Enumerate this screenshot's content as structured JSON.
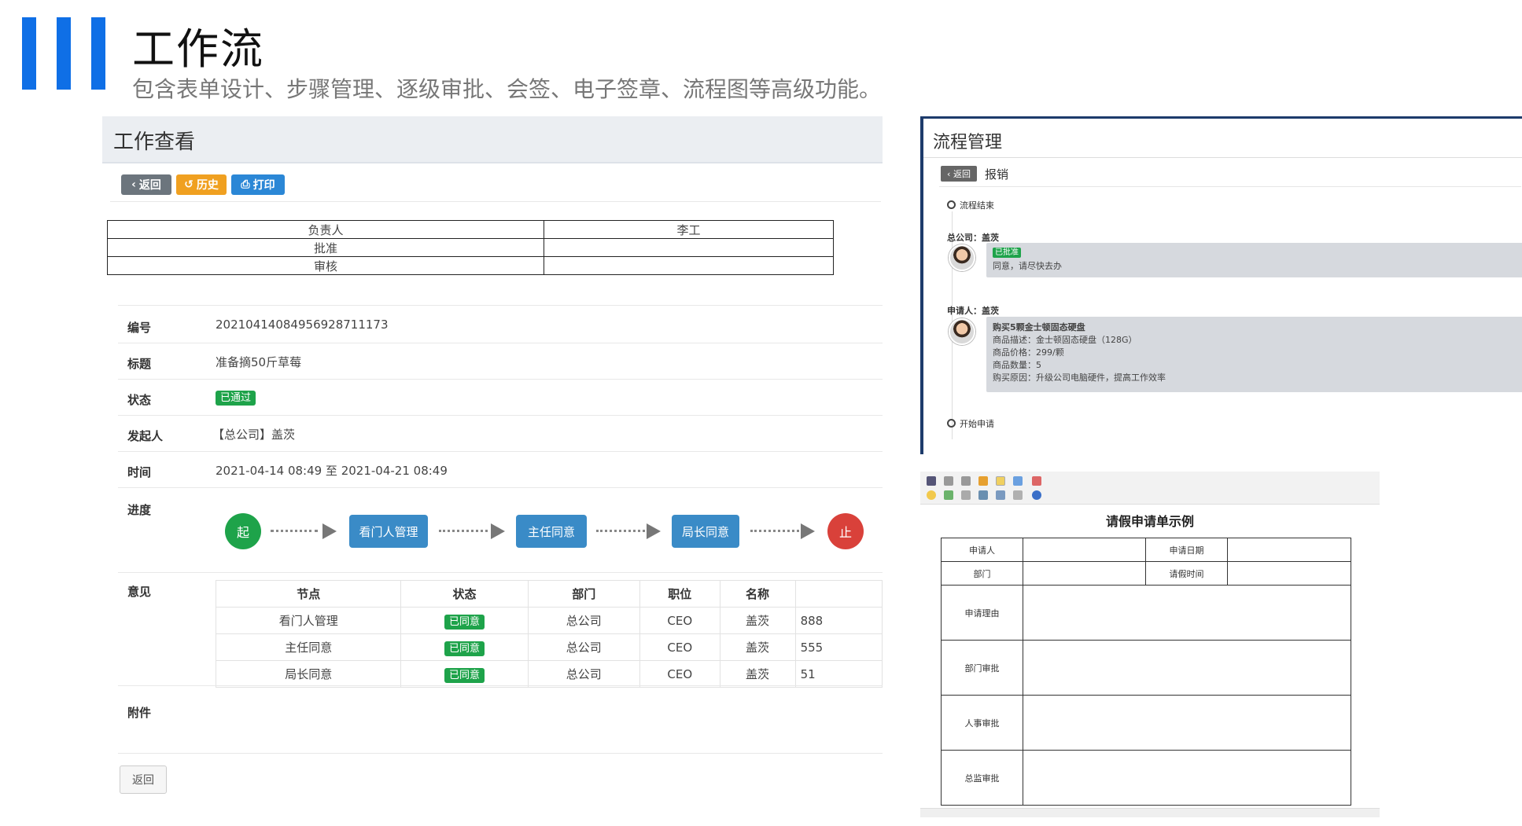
{
  "header": {
    "title": "工作流",
    "subtitle": "包含表单设计、步骤管理、逐级审批、会签、电子签章、流程图等高级功能。"
  },
  "work_view": {
    "title": "工作查看",
    "buttons": {
      "back": "返回",
      "history": "历史",
      "print": "打印"
    },
    "sign_table": [
      [
        "负责人",
        "李工"
      ],
      [
        "批准",
        ""
      ],
      [
        "审核",
        ""
      ]
    ],
    "fields": {
      "number_label": "编号",
      "number": "20210414084956928711173",
      "title_label": "标题",
      "title": "准备摘50斤草莓",
      "status_label": "状态",
      "status": "已通过",
      "initiator_label": "发起人",
      "initiator": "【总公司】盖茨",
      "time_label": "时间",
      "time": "2021-04-14 08:49 至 2021-04-21 08:49",
      "progress_label": "进度",
      "opinion_label": "意见",
      "attachment_label": "附件"
    },
    "flow": {
      "start": "起",
      "steps": [
        "看门人管理",
        "主任同意",
        "局长同意"
      ],
      "end": "止"
    },
    "opinion_headers": [
      "节点",
      "状态",
      "部门",
      "职位",
      "名称",
      ""
    ],
    "opinion_rows": [
      {
        "node": "看门人管理",
        "status": "已同意",
        "dept": "总公司",
        "position": "CEO",
        "name": "盖茨",
        "note": "888"
      },
      {
        "node": "主任同意",
        "status": "已同意",
        "dept": "总公司",
        "position": "CEO",
        "name": "盖茨",
        "note": "555"
      },
      {
        "node": "局长同意",
        "status": "已同意",
        "dept": "总公司",
        "position": "CEO",
        "name": "盖茨",
        "note": "51"
      }
    ],
    "footer_back": "返回"
  },
  "process_mgmt": {
    "title": "流程管理",
    "back": "返回",
    "crumb": "报销",
    "end_node": "流程结束",
    "approver": "总公司：盖茨",
    "approved_badge": "已批准",
    "approved_comment": "同意，请尽快去办",
    "applicant": "申请人：盖茨",
    "item_title": "购买5颗金士顿固态硬盘",
    "item_lines": [
      "商品描述：金士顿固态硬盘（128G）",
      "商品价格：299/颗",
      "商品数量：5",
      "购买原因：升级公司电脑硬件，提高工作效率"
    ],
    "start_node": "开始申请"
  },
  "leave_form": {
    "title": "请假申请单示例",
    "applicant": "申请人",
    "apply_date": "申请日期",
    "dept": "部门",
    "leave_time": "请假时间",
    "reason": "申请理由",
    "dept_approval": "部门审批",
    "hr_approval": "人事审批",
    "director_approval": "总监审批"
  },
  "colors": {
    "brand_blue": "#0f6fe6",
    "flow_blue": "#3a8bc7",
    "ok_green": "#1ea34a",
    "stop_red": "#d9413a",
    "history_orange": "#f0a020"
  }
}
